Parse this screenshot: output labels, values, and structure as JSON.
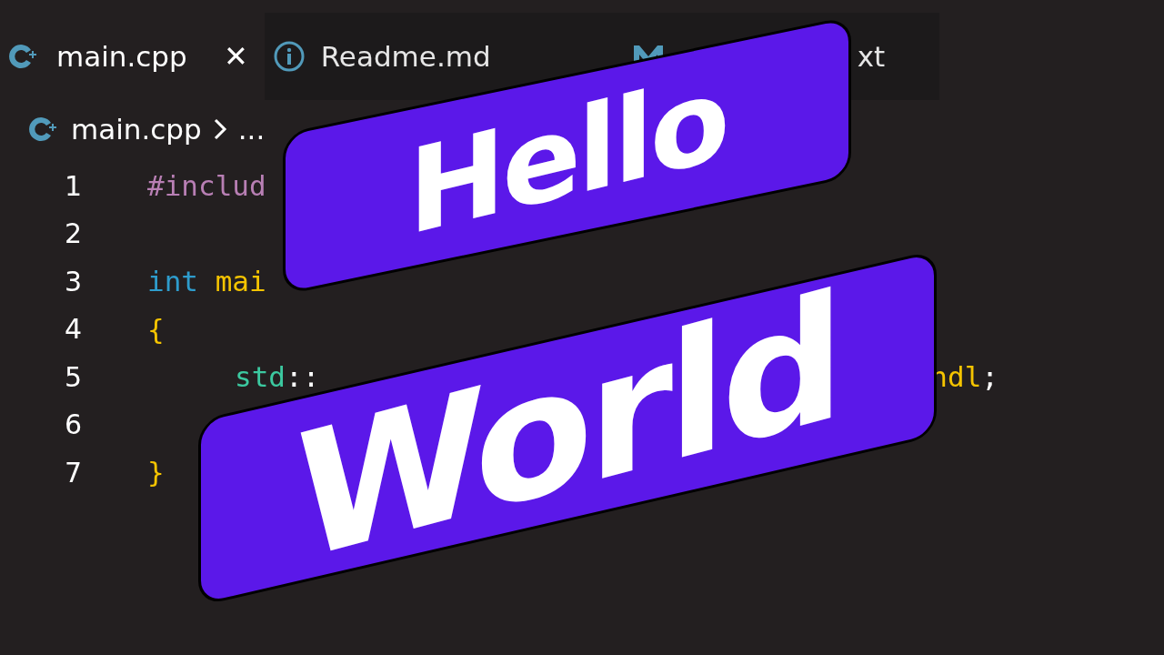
{
  "tabs": [
    {
      "label": "main.cpp",
      "kind": "cpp",
      "selected": true
    },
    {
      "label": "Readme.md",
      "kind": "info",
      "selected": false
    },
    {
      "label": "xt",
      "kind": "markdown",
      "selected": false
    }
  ],
  "close_glyph": "✕",
  "breadcrumb": {
    "file": "main.cpp",
    "more": "..."
  },
  "code_lines": [
    {
      "number": "1",
      "segments": [
        {
          "text": "#includ",
          "kind": "preproc"
        }
      ]
    },
    {
      "number": "2"
    },
    {
      "number": "3",
      "segments": [
        {
          "text": "int ",
          "kind": "keyword"
        },
        {
          "text": "mai",
          "kind": "function"
        }
      ]
    },
    {
      "number": "4",
      "segments": [
        {
          "text": "{",
          "kind": "brace"
        }
      ]
    },
    {
      "number": "5",
      "indent": true,
      "segments": [
        {
          "text": "std",
          "kind": "namespace"
        },
        {
          "text": "::",
          "kind": "punct"
        }
      ],
      "tail_segments": [
        {
          "text": "ndl",
          "kind": "function"
        },
        {
          "text": ";",
          "kind": "punct"
        }
      ]
    },
    {
      "number": "6"
    },
    {
      "number": "7",
      "segments": [
        {
          "text": "}",
          "kind": "brace"
        }
      ]
    }
  ],
  "banners": [
    {
      "text": "Hello"
    },
    {
      "text": "World"
    }
  ]
}
